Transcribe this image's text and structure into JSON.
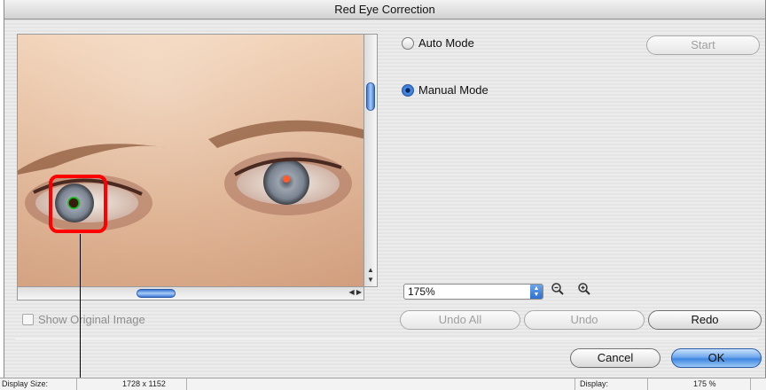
{
  "window": {
    "title": "Red Eye Correction"
  },
  "preview": {
    "show_original_label": "Show Original Image"
  },
  "modes": {
    "auto_label": "Auto Mode",
    "manual_label": "Manual Mode",
    "selected": "manual"
  },
  "buttons": {
    "start": "Start",
    "undo_all": "Undo All",
    "undo": "Undo",
    "redo": "Redo",
    "cancel": "Cancel",
    "ok": "OK"
  },
  "zoom": {
    "value": "175%"
  },
  "status": {
    "display_size_label": "Display Size:",
    "display_size_value": "1728 x 1152",
    "display_label": "Display:",
    "display_value": "175 %"
  },
  "icons": {
    "zoom_out": "zoom-out-icon",
    "zoom_in": "zoom-in-icon"
  }
}
